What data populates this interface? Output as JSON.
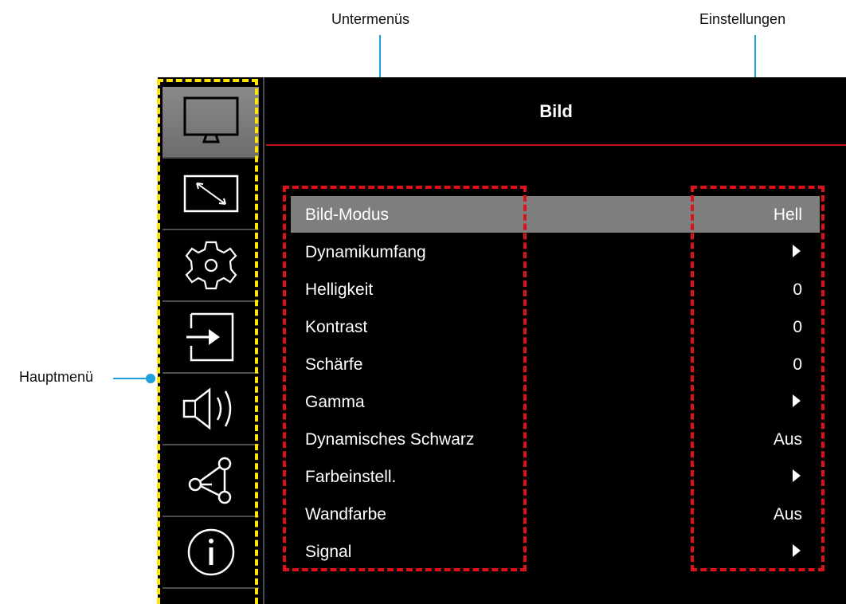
{
  "callouts": {
    "submenus": "Untermenüs",
    "settings": "Einstellungen",
    "mainmenu": "Hauptmenü"
  },
  "osd": {
    "title": "Bild",
    "sidebar": [
      {
        "icon": "monitor-icon",
        "active": true
      },
      {
        "icon": "resize-icon",
        "active": false
      },
      {
        "icon": "gear-icon",
        "active": false
      },
      {
        "icon": "input-icon",
        "active": false
      },
      {
        "icon": "speaker-icon",
        "active": false
      },
      {
        "icon": "share-icon",
        "active": false
      },
      {
        "icon": "info-icon",
        "active": false
      }
    ],
    "rows": [
      {
        "label": "Bild-Modus",
        "value": "Hell",
        "selected": true
      },
      {
        "label": "Dynamikumfang",
        "value": "",
        "submenu": true
      },
      {
        "label": "Helligkeit",
        "value": "0"
      },
      {
        "label": "Kontrast",
        "value": "0"
      },
      {
        "label": "Schärfe",
        "value": "0"
      },
      {
        "label": "Gamma",
        "value": "",
        "submenu": true
      },
      {
        "label": "Dynamisches Schwarz",
        "value": "Aus"
      },
      {
        "label": "Farbeinstell.",
        "value": "",
        "submenu": true
      },
      {
        "label": "Wandfarbe",
        "value": "Aus"
      },
      {
        "label": "Signal",
        "value": "",
        "submenu": true
      }
    ]
  },
  "colors": {
    "callout": "#1ea0dc",
    "highlight_red": "#e0101a",
    "highlight_yellow": "#ffe600",
    "header_rule": "#c0141a",
    "selected_row": "#7e7e7e"
  }
}
